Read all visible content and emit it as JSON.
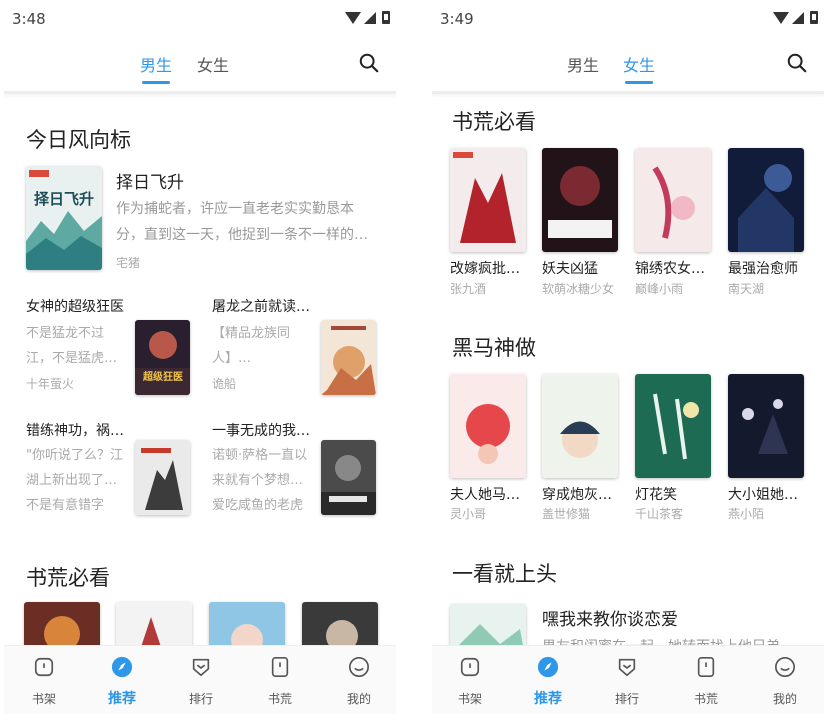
{
  "left": {
    "status": {
      "time": "3:48"
    },
    "tabs": {
      "male": "男生",
      "female": "女生"
    },
    "section1": {
      "title": "今日风向标"
    },
    "highlight": {
      "title": "择日飞升",
      "desc": "作为捕蛇者，许应一直老老实实勤恳本分，直到这一天，他捉到一条不一样的…",
      "author": "宅猪",
      "cover_text": "择日飞升"
    },
    "items": [
      {
        "title": "女神的超级狂医",
        "desc": "不是猛龙不过江，不是猛虎…",
        "author": "十年萤火",
        "cover_text": "超级狂医"
      },
      {
        "title": "屠龙之前就读…",
        "desc": "【精品龙族同人】…",
        "author": "诡船",
        "cover_text": ""
      },
      {
        "title": "错练神功，祸…",
        "desc": "\"你听说了么？江湖上新出现了…不是有意错字",
        "author": "",
        "cover_text": ""
      },
      {
        "title": "一事无成的我…",
        "desc": "诺顿·萨格一直以来就有个梦想…爱吃咸鱼的老虎",
        "author": "",
        "cover_text": ""
      }
    ],
    "section2": {
      "title": "书荒必看"
    },
    "bottomnav": {
      "shelf": "书架",
      "recommend": "推荐",
      "rank": "排行",
      "shuhuang": "书荒",
      "mine": "我的"
    }
  },
  "right": {
    "status": {
      "time": "3:49"
    },
    "tabs": {
      "male": "男生",
      "female": "女生"
    },
    "section1": {
      "title": "书荒必看",
      "books": [
        {
          "title": "改嫁疯批…",
          "author": "张九酒"
        },
        {
          "title": "妖夫凶猛",
          "author": "软萌冰糖少女"
        },
        {
          "title": "锦绣农女…",
          "author": "巅峰小雨"
        },
        {
          "title": "最强治愈师",
          "author": "南天湖"
        }
      ]
    },
    "section2": {
      "title": "黑马神做",
      "books": [
        {
          "title": "夫人她马…",
          "author": "灵小哥"
        },
        {
          "title": "穿成炮灰…",
          "author": "盖世修猫"
        },
        {
          "title": "灯花笑",
          "author": "千山茶客"
        },
        {
          "title": "大小姐她…",
          "author": "燕小陌"
        }
      ]
    },
    "section3": {
      "title": "一看就上头",
      "highlight_title": "嘿我来教你谈恋爱",
      "highlight_desc": "男友和闺蜜在一起，她转而找上他兄弟"
    },
    "bottomnav": {
      "shelf": "书架",
      "recommend": "推荐",
      "rank": "排行",
      "shuhuang": "书荒",
      "mine": "我的"
    }
  },
  "colors": {
    "accent": "#2f97e8"
  }
}
